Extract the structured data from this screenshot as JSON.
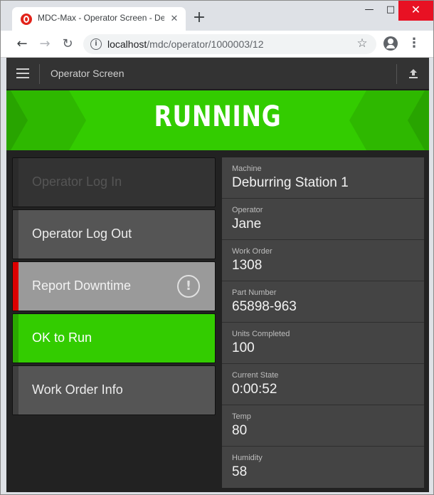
{
  "browser": {
    "tab_title": "MDC-Max - Operator Screen - De",
    "url_host": "localhost",
    "url_path": "/mdc/operator/1000003/12",
    "window_controls": {
      "minimize": "—",
      "maximize": "□",
      "close": "✕"
    },
    "icons": {
      "favicon": "mdc-max-logo-icon",
      "close_tab": "close-icon",
      "new_tab": "plus-icon",
      "back": "arrow-left-icon",
      "forward": "arrow-right-icon",
      "reload": "reload-icon",
      "site_info": "info-icon",
      "bookmark": "star-icon",
      "profile": "account-icon",
      "menu": "more-vert-icon"
    }
  },
  "header": {
    "title": "Operator Screen",
    "menu_icon": "hamburger-icon",
    "upload_icon": "upload-icon"
  },
  "status": {
    "label": "RUNNING",
    "color": "#33cc00"
  },
  "actions": [
    {
      "label": "Operator Log In",
      "state": "disabled",
      "accent": "#2b2b2b"
    },
    {
      "label": "Operator Log Out",
      "state": "enabled",
      "accent": "#3f3f3f"
    },
    {
      "label": "Report Downtime",
      "state": "enabled",
      "accent": "#dd0000",
      "icon": "alert-circle-icon"
    },
    {
      "label": "OK to Run",
      "state": "active",
      "accent": "#33cc00"
    },
    {
      "label": "Work Order Info",
      "state": "enabled",
      "accent": "#3f3f3f"
    }
  ],
  "info": [
    {
      "label": "Machine",
      "value": "Deburring Station 1"
    },
    {
      "label": "Operator",
      "value": "Jane"
    },
    {
      "label": "Work Order",
      "value": "1308"
    },
    {
      "label": "Part Number",
      "value": "65898-963"
    },
    {
      "label": "Units Completed",
      "value": "100"
    },
    {
      "label": "Current State",
      "value": "0:00:52"
    },
    {
      "label": "Temp",
      "value": "80"
    },
    {
      "label": "Humidity",
      "value": "58"
    }
  ]
}
